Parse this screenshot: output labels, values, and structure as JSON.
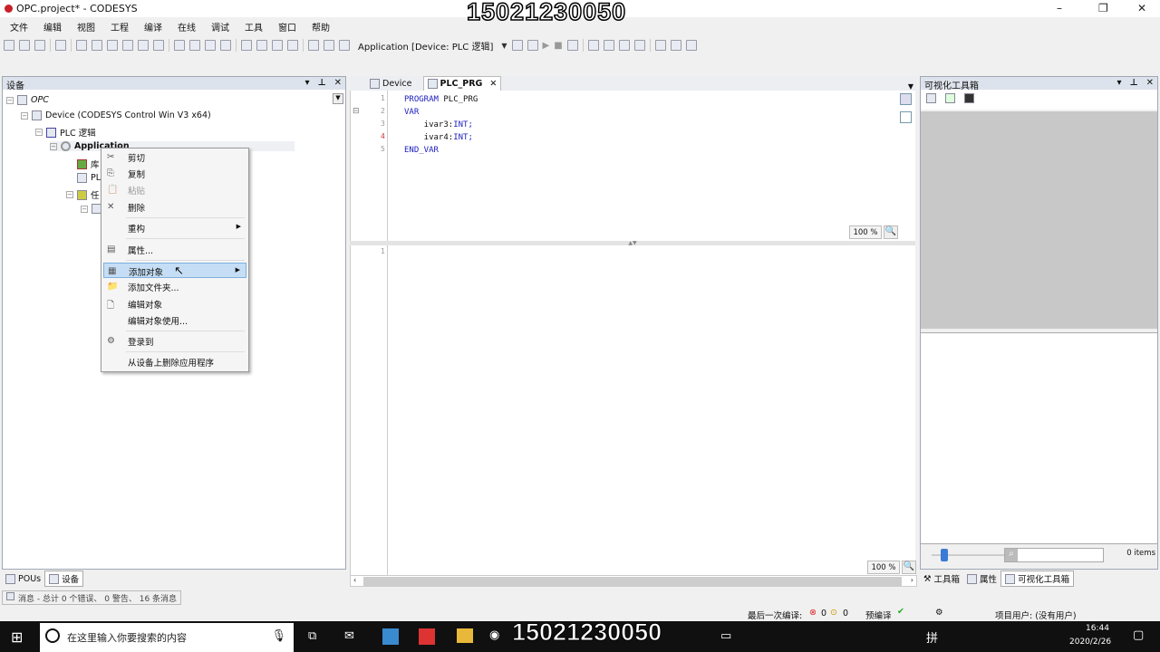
{
  "window": {
    "title": "OPC.project* - CODESYS",
    "controls": [
      "–",
      "❐",
      "✕"
    ]
  },
  "watermark_top": "15021230050",
  "watermark_bottom": "15021230050",
  "menu": [
    "文件",
    "编辑",
    "视图",
    "工程",
    "编译",
    "在线",
    "调试",
    "工具",
    "窗口",
    "帮助"
  ],
  "toolbar": {
    "active_app": "Application [Device: PLC 逻辑]"
  },
  "devices_panel": {
    "title": "设备",
    "tree": [
      "OPC",
      "Device (CODESYS Control Win V3 x64)",
      "PLC 逻辑",
      "Application",
      "库",
      "PL",
      "任"
    ]
  },
  "context_menu": {
    "items": [
      {
        "label": "剪切",
        "icon": "✂"
      },
      {
        "label": "复制",
        "icon": "⎘"
      },
      {
        "label": "粘贴",
        "icon": "📋"
      },
      {
        "label": "删除",
        "icon": "✕"
      },
      {
        "label": "重构"
      },
      {
        "label": "属性...",
        "icon": "▤"
      },
      {
        "label": "添加对象",
        "icon": "▦"
      },
      {
        "label": "添加文件夹...",
        "icon": "📁"
      },
      {
        "label": "编辑对象",
        "icon": "🗋"
      },
      {
        "label": "编辑对象使用..."
      },
      {
        "label": "登录到",
        "icon": "⚙"
      },
      {
        "label": "从设备上删除应用程序"
      }
    ]
  },
  "left_tabs": [
    "POUs",
    "设备"
  ],
  "messages": "消息 - 总计 0 个错误、 0 警告、 16 条消息",
  "editor": {
    "tabs": [
      "Device",
      "PLC_PRG"
    ],
    "code": [
      {
        "n": "1",
        "kw": "PROGRAM",
        "rest": " PLC_PRG"
      },
      {
        "n": "2",
        "kw": "VAR",
        "rest": ""
      },
      {
        "n": "3",
        "pre": "    ivar3:",
        "kw": "INT;"
      },
      {
        "n": "4",
        "pre": "    ivar4:",
        "kw": "INT;"
      },
      {
        "n": "5",
        "kw": "END_VAR",
        "rest": ""
      }
    ],
    "lower_line": "1",
    "zoom_top": "100 %",
    "zoom_bottom": "100 %"
  },
  "right_panel": {
    "title": "可视化工具箱",
    "items_count": "0 items",
    "tabs": [
      "工具箱",
      "属性",
      "可视化工具箱"
    ]
  },
  "status": {
    "last_compile": "最后一次编译:",
    "errors": "0",
    "warnings": "0",
    "precompile": "预编译",
    "user": "项目用户: (没有用户)"
  },
  "taskbar": {
    "search_placeholder": "在这里输入你要搜索的内容",
    "time": "16:44",
    "date": "2020/2/26"
  }
}
